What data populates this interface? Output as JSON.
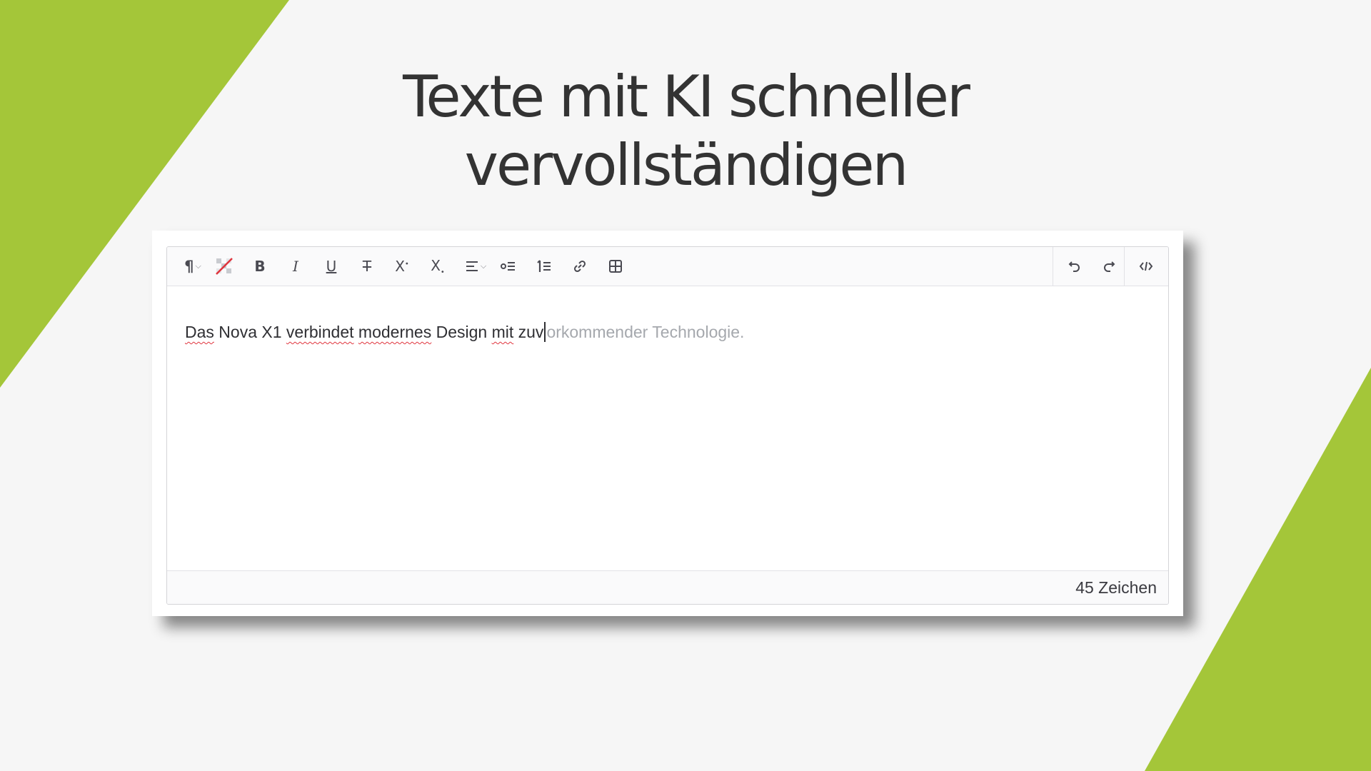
{
  "slide": {
    "title_line1": "Texte mit KI schneller",
    "title_line2": "vervollständigen",
    "accent_color": "#a4c639",
    "background_color": "#f6f6f6"
  },
  "editor": {
    "toolbar": {
      "paragraph_icon": "¶",
      "bold_label": "B",
      "italic_label": "I",
      "underline_label": "U",
      "strikethrough_label": "T",
      "superscript_label": "X",
      "subscript_label": "X",
      "left_items": [
        "paragraph-format",
        "clear-formatting",
        "bold",
        "italic",
        "underline",
        "strikethrough",
        "superscript",
        "subscript",
        "align",
        "bulleted-list",
        "numbered-list",
        "link",
        "table"
      ],
      "right_items": [
        "undo",
        "redo",
        "source-code"
      ]
    },
    "content": {
      "words_flagged": [
        "Das",
        "verbindet",
        "modernes",
        "mit"
      ],
      "typed_text_parts": [
        "Das",
        " Nova X1 ",
        "verbindet",
        " ",
        "modernes",
        " Design ",
        "mit",
        " zuv"
      ],
      "suggestion_text": "orkommender Technologie."
    },
    "status": {
      "char_count": "45 Zeichen"
    }
  }
}
